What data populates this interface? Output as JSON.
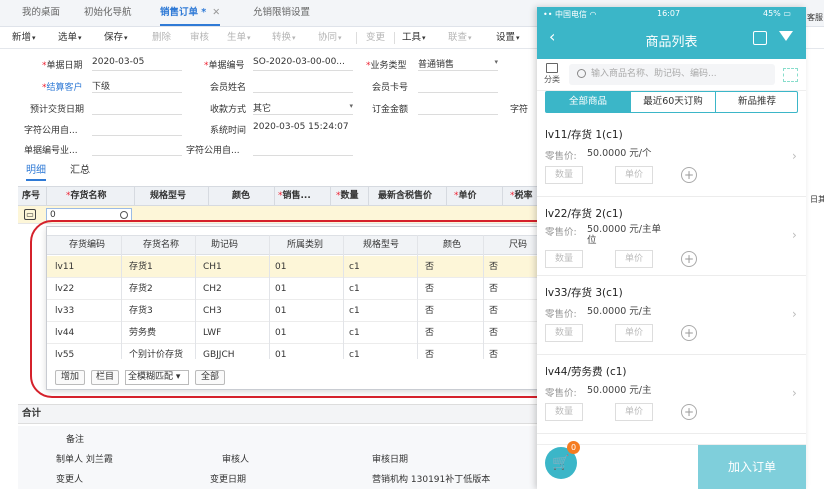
{
  "tabs": [
    {
      "label": "我的桌面"
    },
    {
      "label": "初始化导航"
    },
    {
      "label": "销售订单 *"
    },
    {
      "label": "允销限销设置"
    }
  ],
  "toolbar": [
    "新增",
    "选单",
    "保存",
    "删除",
    "审核",
    "生单",
    "转换",
    "协同",
    "变更",
    "工具",
    "联查",
    "设置"
  ],
  "form": {
    "order_date_label": "单据日期",
    "order_date": "2020-03-05",
    "order_no_label": "单据编号",
    "order_no": "SO-2020-03-00-00...",
    "biz_type_label": "业务类型",
    "biz_type": "普通销售",
    "settle_customer_label": "结算客户",
    "settle_customer": "下级",
    "member_label": "会员姓名",
    "member_card_label": "会员卡号",
    "expected_date_label": "预计交货日期",
    "payment_label": "收款方式",
    "payment": "其它",
    "deposit_label": "订金金额",
    "custom_str_label": "字符公用自...",
    "system_time_label": "系统时间",
    "system_time": "2020-03-05 15:24:07",
    "doc_no_label": "单据编号业...",
    "custom_str2_label": "字符公用自...",
    "custom_str3_label": "字符"
  },
  "sub_tabs": [
    "明细",
    "汇总"
  ],
  "grid": {
    "headers": [
      "序号",
      "存货名称",
      "规格型号",
      "颜色",
      "销售...",
      "数量",
      "最新含税售价",
      "单价",
      "税率"
    ],
    "input_value": "0"
  },
  "popup": {
    "headers": [
      "存货编码",
      "存货名称",
      "助记码",
      "所属类别",
      "规格型号",
      "颜色",
      "尺码"
    ],
    "rows": [
      [
        "lv11",
        "存货1",
        "CH1",
        "01",
        "c1",
        "否",
        "否"
      ],
      [
        "lv22",
        "存货2",
        "CH2",
        "01",
        "c1",
        "否",
        "否"
      ],
      [
        "lv33",
        "存货3",
        "CH3",
        "01",
        "c1",
        "否",
        "否"
      ],
      [
        "lv44",
        "劳务费",
        "LWF",
        "01",
        "c1",
        "否",
        "否"
      ],
      [
        "lv55",
        "个别计价存货",
        "GBJJCH",
        "01",
        "c1",
        "否",
        "否"
      ]
    ],
    "btn_add": "增加",
    "btn_column": "栏目",
    "match_mode": "全模糊匹配",
    "btn_all": "全部"
  },
  "summary_label": "合计",
  "bottom": {
    "remark_label": "备注",
    "maker_label": "制单人",
    "maker": "刘兰霞",
    "auditor_label": "审核人",
    "audit_date_label": "审核日期",
    "changer_label": "变更人",
    "change_date_label": "变更日期",
    "org_label": "营销机构",
    "org": "130191补丁低版本"
  },
  "edge": {
    "right_top": "客服",
    "right_mid": "日其"
  },
  "phone": {
    "carrier": "中国电信",
    "time": "16:07",
    "battery": "45%",
    "title": "商品列表",
    "category_label": "分类",
    "search_placeholder": "输入商品名称、助记码、编码...",
    "segments": [
      "全部商品",
      "最近60天订购",
      "新品推荐"
    ],
    "price_label": "零售价:",
    "qty_placeholder": "数量",
    "unit_placeholder": "单价",
    "items": [
      {
        "name": "lv11/存货 1(c1)",
        "price": "50.0000 元/个"
      },
      {
        "name": "lv22/存货 2(c1)",
        "price": "50.0000 元/主单位"
      },
      {
        "name": "lv33/存货 3(c1)",
        "price": "50.0000 元/主"
      },
      {
        "name": "lv44/劳务费 (c1)",
        "price": "50.0000 元/主"
      }
    ],
    "cart_count": "0",
    "add_order": "加入订单"
  }
}
